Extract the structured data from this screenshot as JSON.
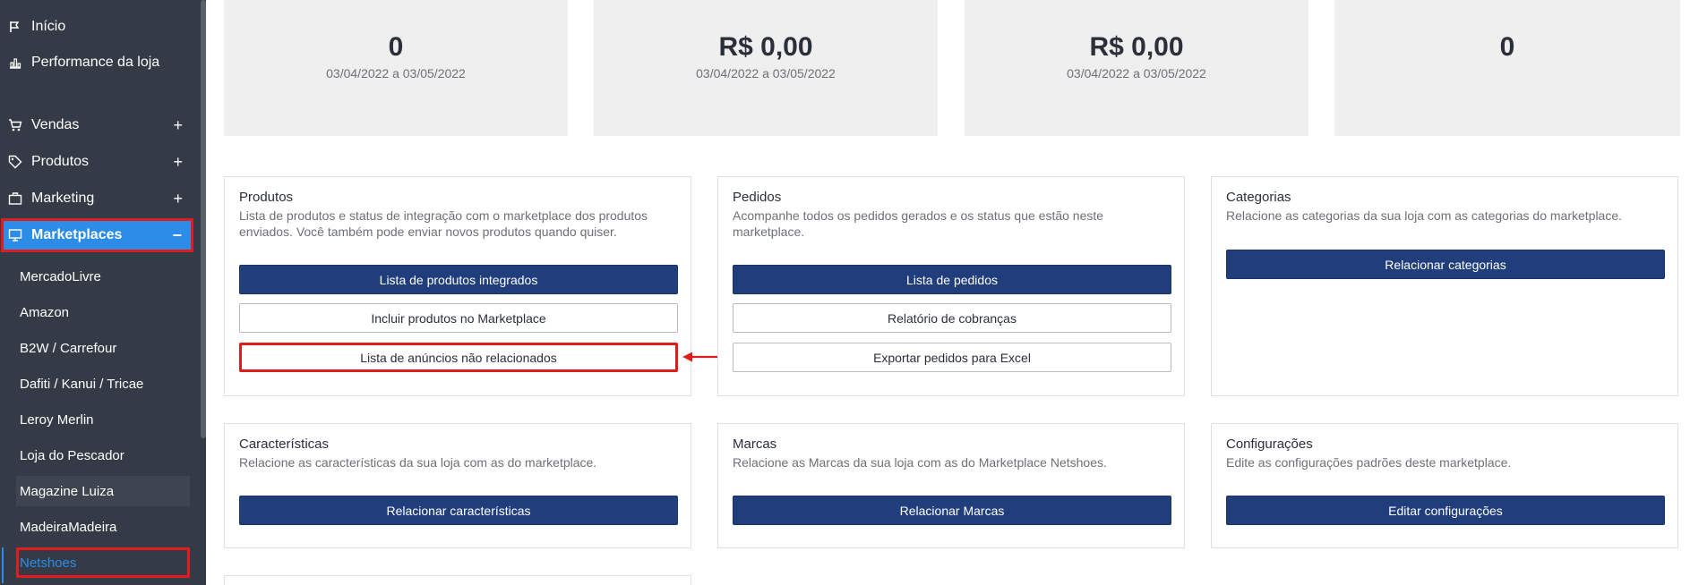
{
  "sidebar": {
    "top_items": [
      {
        "label": "Início",
        "icon": "flag-icon"
      },
      {
        "label": "Performance da loja",
        "icon": "bar-chart-icon"
      }
    ],
    "sections": [
      {
        "label": "Vendas",
        "icon": "cart-icon",
        "toggle": "+"
      },
      {
        "label": "Produtos",
        "icon": "tag-icon",
        "toggle": "+"
      },
      {
        "label": "Marketing",
        "icon": "briefcase-icon",
        "toggle": "+"
      },
      {
        "label": "Marketplaces",
        "icon": "monitor-icon",
        "toggle": "−"
      }
    ],
    "marketplaces": [
      "MercadoLivre",
      "Amazon",
      "B2W / Carrefour",
      "Dafiti / Kanui / Tricae",
      "Leroy Merlin",
      "Loja do Pescador",
      "Magazine Luiza",
      "MadeiraMadeira",
      "Netshoes"
    ]
  },
  "stats": [
    {
      "value": "0",
      "period": "03/04/2022 a 03/05/2022"
    },
    {
      "value": "R$ 0,00",
      "period": "03/04/2022 a 03/05/2022"
    },
    {
      "value": "R$ 0,00",
      "period": "03/04/2022 a 03/05/2022"
    },
    {
      "value": "0",
      "period": ""
    }
  ],
  "panels": {
    "produtos": {
      "title": "Produtos",
      "desc": "Lista de produtos e status de integração com o marketplace dos produtos enviados. Você também pode enviar novos produtos quando quiser.",
      "btn_list": "Lista de produtos integrados",
      "btn_include": "Incluir produtos no Marketplace",
      "btn_unrelated": "Lista de anúncios não relacionados"
    },
    "pedidos": {
      "title": "Pedidos",
      "desc": "Acompanhe todos os pedidos gerados e os status que estão neste marketplace.",
      "btn_list": "Lista de pedidos",
      "btn_report": "Relatório de cobranças",
      "btn_export": "Exportar pedidos para Excel"
    },
    "categorias": {
      "title": "Categorias",
      "desc": "Relacione as categorias da sua loja com as categorias do marketplace.",
      "btn": "Relacionar categorias"
    },
    "caracteristicas": {
      "title": "Características",
      "desc": "Relacione as características da sua loja com as do marketplace.",
      "btn": "Relacionar características"
    },
    "marcas": {
      "title": "Marcas",
      "desc": "Relacione as Marcas da sua loja com as do Marketplace Netshoes.",
      "btn": "Relacionar Marcas"
    },
    "configuracoes": {
      "title": "Configurações",
      "desc": "Edite as configurações padrões deste marketplace.",
      "btn": "Editar configurações"
    }
  },
  "colors": {
    "sidebar_bg": "#343a46",
    "accent": "#2b8de8",
    "primary_button": "#203e7c",
    "highlight": "#e01c1c"
  }
}
